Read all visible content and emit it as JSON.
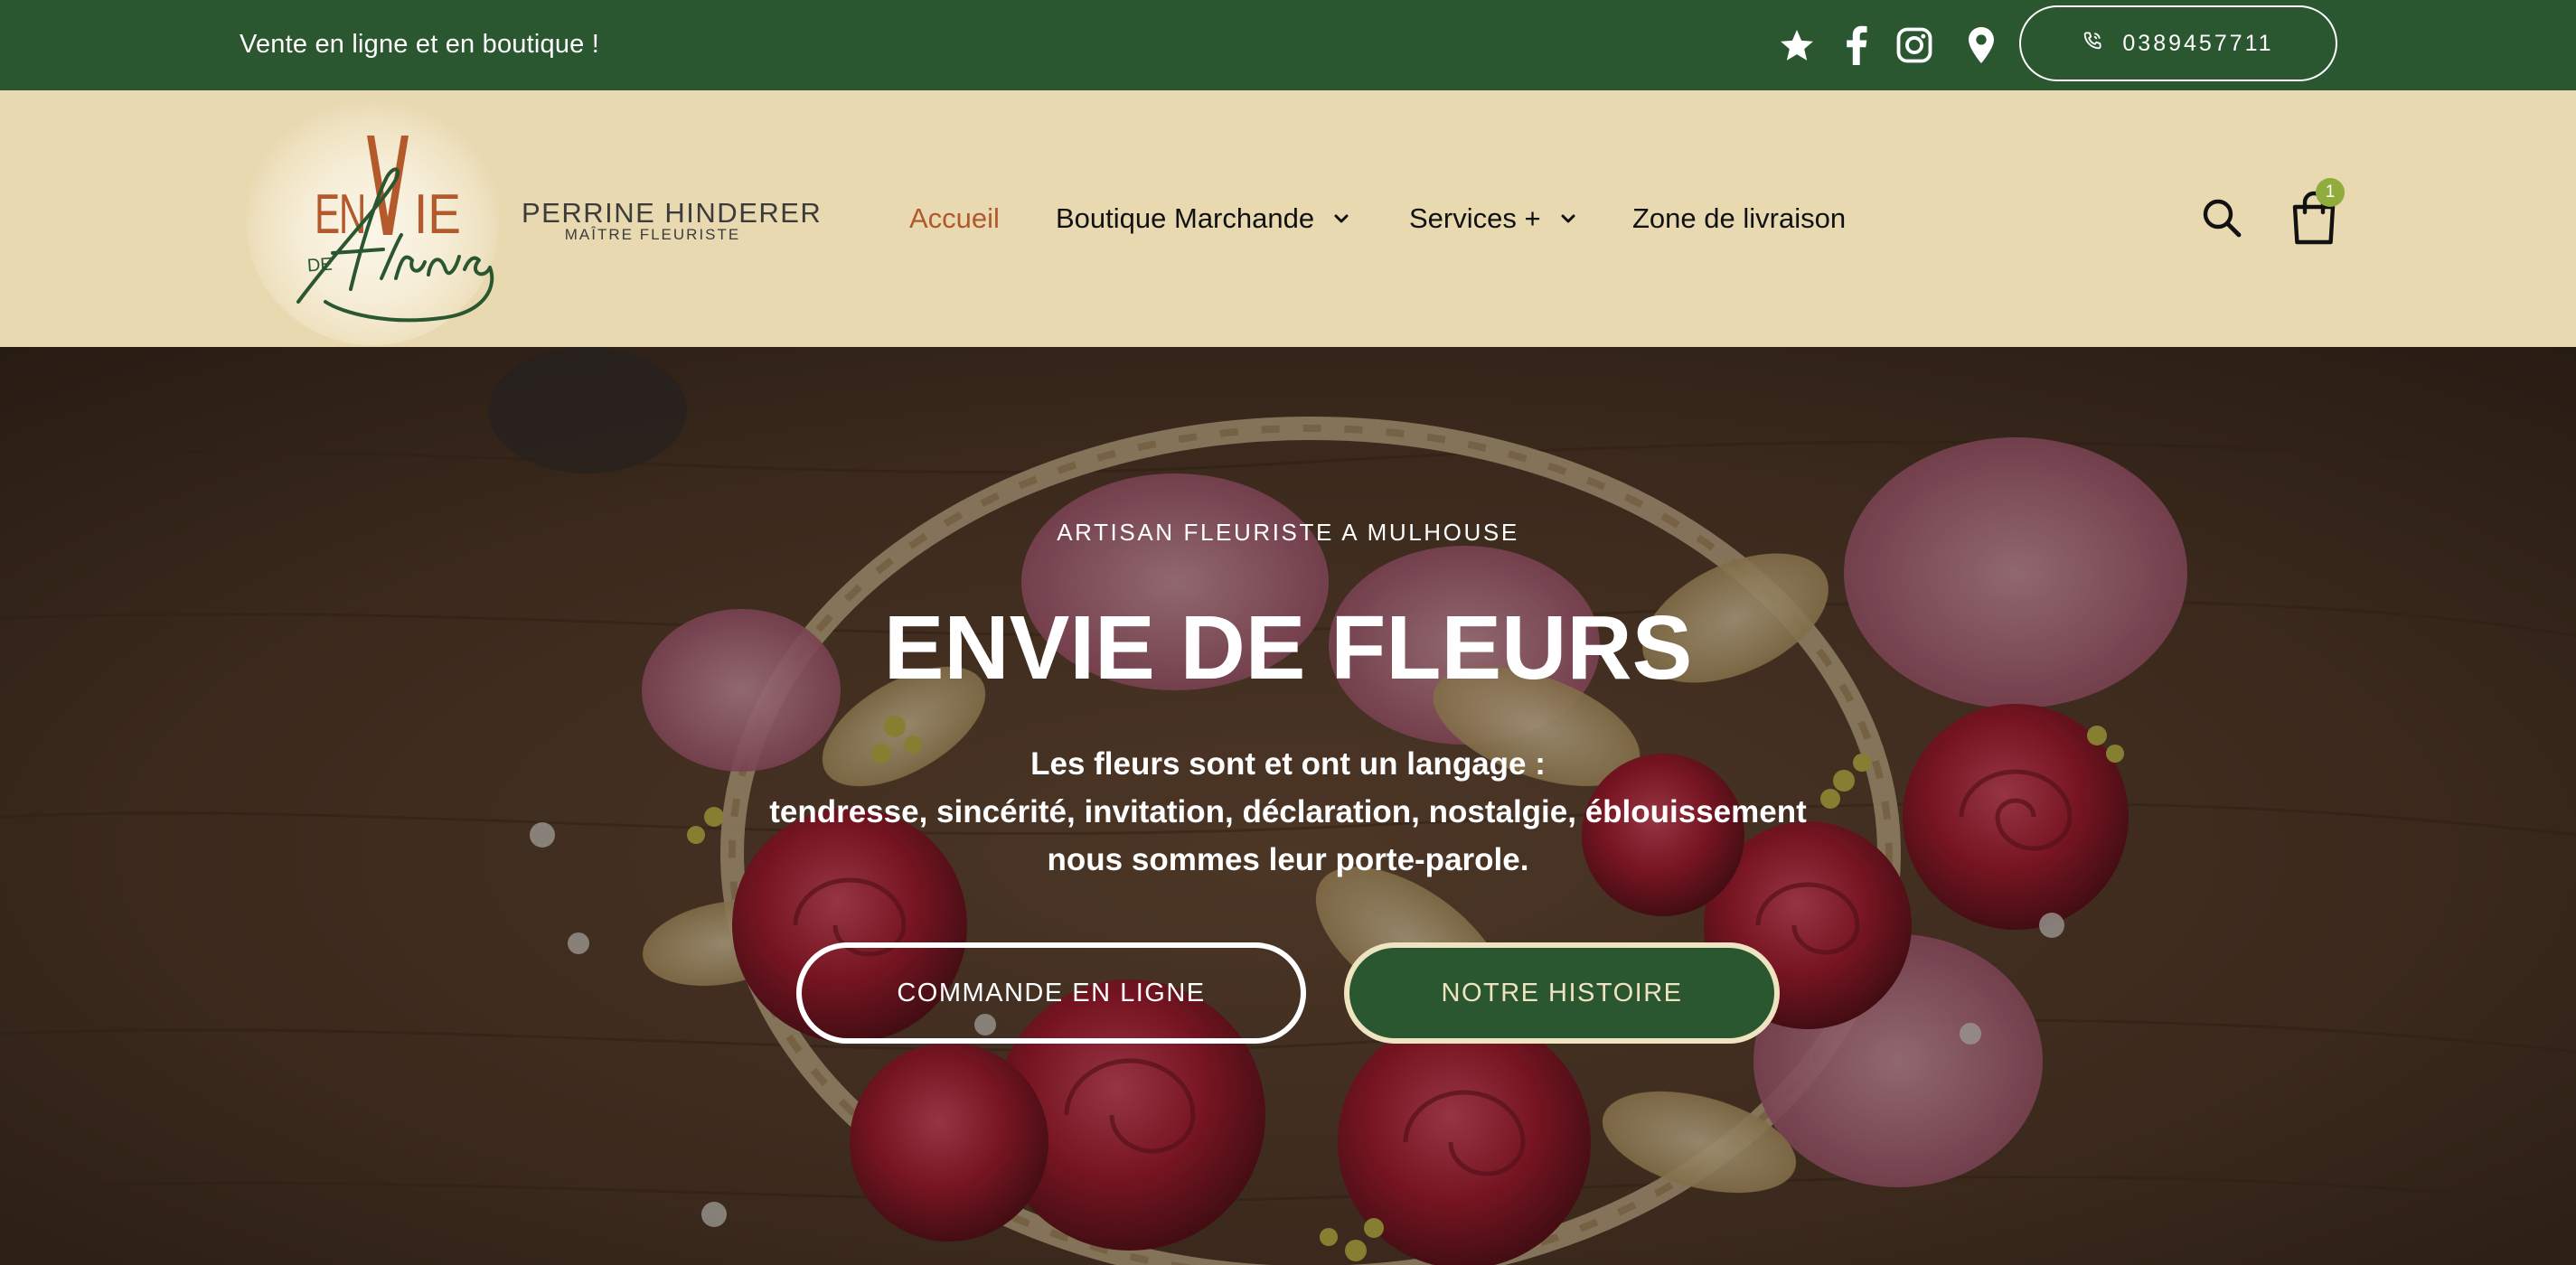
{
  "topbar": {
    "tagline": "Vente en ligne et en boutique !",
    "social_icons": [
      "star-icon",
      "facebook-icon",
      "instagram-icon",
      "location-pin-icon"
    ],
    "phone": "0389457711",
    "background_color": "#2a5730"
  },
  "header": {
    "logo": {
      "mark_text_top": "ENVIE",
      "mark_text_de": "DE",
      "mark_text_script": "fleurs"
    },
    "brand_name": "PERRINE HINDERER",
    "brand_subtitle": "MAÎTRE FLEURISTE",
    "nav": [
      {
        "label": "Accueil",
        "active": true,
        "has_dropdown": false
      },
      {
        "label": "Boutique Marchande",
        "active": false,
        "has_dropdown": true
      },
      {
        "label": "Services +",
        "active": false,
        "has_dropdown": true
      },
      {
        "label": "Zone de livraison",
        "active": false,
        "has_dropdown": false
      }
    ],
    "cart_count": "1",
    "background_color": "#e8d9b1",
    "active_color": "#b05a2b"
  },
  "hero": {
    "kicker": "ARTISAN FLEURISTE A MULHOUSE",
    "title": "ENVIE DE FLEURS",
    "description_lines": [
      "Les fleurs sont et ont un langage :",
      "tendresse, sincérité, invitation, déclaration, nostalgie, éblouissement",
      "nous sommes leur porte-parole."
    ],
    "buttons": {
      "primary": "COMMANDE EN LIGNE",
      "secondary": "NOTRE HISTOIRE"
    }
  }
}
